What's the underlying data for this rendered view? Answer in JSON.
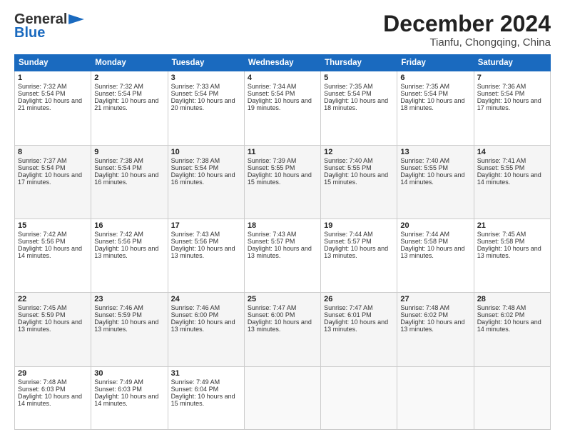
{
  "logo": {
    "line1": "General",
    "line2": "Blue"
  },
  "header": {
    "month": "December 2024",
    "location": "Tianfu, Chongqing, China"
  },
  "weekdays": [
    "Sunday",
    "Monday",
    "Tuesday",
    "Wednesday",
    "Thursday",
    "Friday",
    "Saturday"
  ],
  "weeks": [
    [
      {
        "day": "1",
        "sunrise": "Sunrise: 7:32 AM",
        "sunset": "Sunset: 5:54 PM",
        "daylight": "Daylight: 10 hours and 21 minutes."
      },
      {
        "day": "2",
        "sunrise": "Sunrise: 7:32 AM",
        "sunset": "Sunset: 5:54 PM",
        "daylight": "Daylight: 10 hours and 21 minutes."
      },
      {
        "day": "3",
        "sunrise": "Sunrise: 7:33 AM",
        "sunset": "Sunset: 5:54 PM",
        "daylight": "Daylight: 10 hours and 20 minutes."
      },
      {
        "day": "4",
        "sunrise": "Sunrise: 7:34 AM",
        "sunset": "Sunset: 5:54 PM",
        "daylight": "Daylight: 10 hours and 19 minutes."
      },
      {
        "day": "5",
        "sunrise": "Sunrise: 7:35 AM",
        "sunset": "Sunset: 5:54 PM",
        "daylight": "Daylight: 10 hours and 18 minutes."
      },
      {
        "day": "6",
        "sunrise": "Sunrise: 7:35 AM",
        "sunset": "Sunset: 5:54 PM",
        "daylight": "Daylight: 10 hours and 18 minutes."
      },
      {
        "day": "7",
        "sunrise": "Sunrise: 7:36 AM",
        "sunset": "Sunset: 5:54 PM",
        "daylight": "Daylight: 10 hours and 17 minutes."
      }
    ],
    [
      {
        "day": "8",
        "sunrise": "Sunrise: 7:37 AM",
        "sunset": "Sunset: 5:54 PM",
        "daylight": "Daylight: 10 hours and 17 minutes."
      },
      {
        "day": "9",
        "sunrise": "Sunrise: 7:38 AM",
        "sunset": "Sunset: 5:54 PM",
        "daylight": "Daylight: 10 hours and 16 minutes."
      },
      {
        "day": "10",
        "sunrise": "Sunrise: 7:38 AM",
        "sunset": "Sunset: 5:54 PM",
        "daylight": "Daylight: 10 hours and 16 minutes."
      },
      {
        "day": "11",
        "sunrise": "Sunrise: 7:39 AM",
        "sunset": "Sunset: 5:55 PM",
        "daylight": "Daylight: 10 hours and 15 minutes."
      },
      {
        "day": "12",
        "sunrise": "Sunrise: 7:40 AM",
        "sunset": "Sunset: 5:55 PM",
        "daylight": "Daylight: 10 hours and 15 minutes."
      },
      {
        "day": "13",
        "sunrise": "Sunrise: 7:40 AM",
        "sunset": "Sunset: 5:55 PM",
        "daylight": "Daylight: 10 hours and 14 minutes."
      },
      {
        "day": "14",
        "sunrise": "Sunrise: 7:41 AM",
        "sunset": "Sunset: 5:55 PM",
        "daylight": "Daylight: 10 hours and 14 minutes."
      }
    ],
    [
      {
        "day": "15",
        "sunrise": "Sunrise: 7:42 AM",
        "sunset": "Sunset: 5:56 PM",
        "daylight": "Daylight: 10 hours and 14 minutes."
      },
      {
        "day": "16",
        "sunrise": "Sunrise: 7:42 AM",
        "sunset": "Sunset: 5:56 PM",
        "daylight": "Daylight: 10 hours and 13 minutes."
      },
      {
        "day": "17",
        "sunrise": "Sunrise: 7:43 AM",
        "sunset": "Sunset: 5:56 PM",
        "daylight": "Daylight: 10 hours and 13 minutes."
      },
      {
        "day": "18",
        "sunrise": "Sunrise: 7:43 AM",
        "sunset": "Sunset: 5:57 PM",
        "daylight": "Daylight: 10 hours and 13 minutes."
      },
      {
        "day": "19",
        "sunrise": "Sunrise: 7:44 AM",
        "sunset": "Sunset: 5:57 PM",
        "daylight": "Daylight: 10 hours and 13 minutes."
      },
      {
        "day": "20",
        "sunrise": "Sunrise: 7:44 AM",
        "sunset": "Sunset: 5:58 PM",
        "daylight": "Daylight: 10 hours and 13 minutes."
      },
      {
        "day": "21",
        "sunrise": "Sunrise: 7:45 AM",
        "sunset": "Sunset: 5:58 PM",
        "daylight": "Daylight: 10 hours and 13 minutes."
      }
    ],
    [
      {
        "day": "22",
        "sunrise": "Sunrise: 7:45 AM",
        "sunset": "Sunset: 5:59 PM",
        "daylight": "Daylight: 10 hours and 13 minutes."
      },
      {
        "day": "23",
        "sunrise": "Sunrise: 7:46 AM",
        "sunset": "Sunset: 5:59 PM",
        "daylight": "Daylight: 10 hours and 13 minutes."
      },
      {
        "day": "24",
        "sunrise": "Sunrise: 7:46 AM",
        "sunset": "Sunset: 6:00 PM",
        "daylight": "Daylight: 10 hours and 13 minutes."
      },
      {
        "day": "25",
        "sunrise": "Sunrise: 7:47 AM",
        "sunset": "Sunset: 6:00 PM",
        "daylight": "Daylight: 10 hours and 13 minutes."
      },
      {
        "day": "26",
        "sunrise": "Sunrise: 7:47 AM",
        "sunset": "Sunset: 6:01 PM",
        "daylight": "Daylight: 10 hours and 13 minutes."
      },
      {
        "day": "27",
        "sunrise": "Sunrise: 7:48 AM",
        "sunset": "Sunset: 6:02 PM",
        "daylight": "Daylight: 10 hours and 13 minutes."
      },
      {
        "day": "28",
        "sunrise": "Sunrise: 7:48 AM",
        "sunset": "Sunset: 6:02 PM",
        "daylight": "Daylight: 10 hours and 14 minutes."
      }
    ],
    [
      {
        "day": "29",
        "sunrise": "Sunrise: 7:48 AM",
        "sunset": "Sunset: 6:03 PM",
        "daylight": "Daylight: 10 hours and 14 minutes."
      },
      {
        "day": "30",
        "sunrise": "Sunrise: 7:49 AM",
        "sunset": "Sunset: 6:03 PM",
        "daylight": "Daylight: 10 hours and 14 minutes."
      },
      {
        "day": "31",
        "sunrise": "Sunrise: 7:49 AM",
        "sunset": "Sunset: 6:04 PM",
        "daylight": "Daylight: 10 hours and 15 minutes."
      },
      null,
      null,
      null,
      null
    ]
  ]
}
